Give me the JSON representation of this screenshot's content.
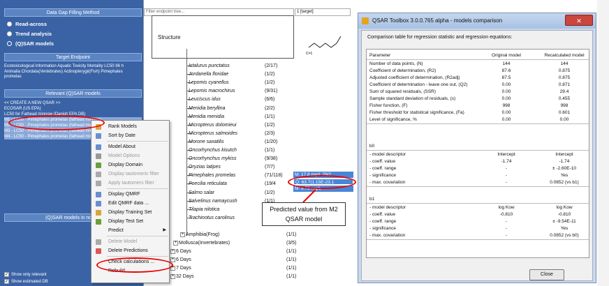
{
  "left_panel": {
    "method_header": "Data Gap Filling Method",
    "methods": [
      "Read-across",
      "Trend analysis",
      "(Q)SAR models"
    ],
    "target_header": "Target Endpoint",
    "target_text": "Ecotoxicological Information Aquatic Toxicity Mortality LC50 96 h Animalia Chordata(Vertebrates) Actinopterygii(Fish) Pimephales promelas",
    "relevant_header": "Relevant (Q)SAR models",
    "models": [
      "<< CREATE A NEW QSAR >>",
      "ECOSAR (US EPA)",
      "LC50 for Fathead minnow (Danish EPA DB)",
      "M1 - LC50 - Pimephales promelas (fathead minnow)",
      "M2 - LC50 - Pimephales promelas (fathead minnow)",
      "M3 - LC50 - Pimephales promelas (fathead minnow)",
      "M4 - LC50 - Pimephales promelas (fathead minnow)"
    ],
    "models_in_node_header": "(Q)SAR models in node",
    "checkboxes": [
      "Show only relevant",
      "Show estimated DB"
    ]
  },
  "middle": {
    "filter_placeholder": "Filter endpoint tree...",
    "target_col": "1 [target]",
    "structure_label": "Structure",
    "molecule_label": "C=1",
    "species": [
      {
        "name": "Ictalurus punctatus",
        "count": "(2/17)"
      },
      {
        "name": "Jordanella floridae",
        "count": "(1/2)"
      },
      {
        "name": "Lepomis cyanellus",
        "count": "(1/2)"
      },
      {
        "name": "Lepomis macrochirus",
        "count": "(9/31)"
      },
      {
        "name": "Leuciscus idus",
        "count": "(6/6)"
      },
      {
        "name": "Menidia beryllina",
        "count": "(2/2)"
      },
      {
        "name": "Menidia menidia",
        "count": "(1/1)"
      },
      {
        "name": "Micropterus dolomieui",
        "count": "(1/2)"
      },
      {
        "name": "Micropterus salmoides",
        "count": "(2/3)"
      },
      {
        "name": "Morone saxatilis",
        "count": "(1/20)"
      },
      {
        "name": "Oncorhynchus kisutch",
        "count": "(1/1)"
      },
      {
        "name": "Oncorhynchus mykiss",
        "count": "(9/38)"
      },
      {
        "name": "Oryzias latipes",
        "count": "(7/7)"
      },
      {
        "name": "Pimephales promelas",
        "count": "(71/118)"
      },
      {
        "name": "Poecilia reticulata",
        "count": "(19/4"
      },
      {
        "name": "Salmo salar",
        "count": "(1/2)"
      },
      {
        "name": "Salvelinus namaycush",
        "count": "(1/1)"
      },
      {
        "name": "Tilapia nilotica",
        "count": "(1/1)"
      },
      {
        "name": "Trachinotus carolinus",
        "count": "(1/1)"
      }
    ],
    "amphibia": {
      "name": "Amphibia(Frog)",
      "count": "(1/1)"
    },
    "mollusca": {
      "name": "Mollusca(Invertebrates)",
      "count": "(3/5)"
    },
    "days": [
      {
        "name": "6 Days",
        "count": "(1/1)"
      },
      {
        "name": "6 Days",
        "count": "(1/1)"
      },
      {
        "name": "7 Days",
        "count": "(1/1)"
      },
      {
        "name": "32 Days",
        "count": "(1/1)"
      }
    ],
    "pred_values": [
      "M: 17.8 mg/L 29/2",
      "Q: 63.7(1.15E-23.1",
      "M: 9.79 mg/L"
    ],
    "callout": "Predicted value from M2 QSAR model"
  },
  "context_menu": {
    "items": [
      {
        "label": "Rank Models",
        "disabled": false,
        "icon": "rank-icon"
      },
      {
        "label": "Sort by Date",
        "disabled": false,
        "icon": "sort-icon"
      },
      {
        "label": "Model About",
        "disabled": false,
        "icon": "about-icon"
      },
      {
        "label": "Model Options",
        "disabled": true,
        "icon": "options-icon"
      },
      {
        "label": "Display Domain",
        "disabled": false,
        "icon": "domain-icon"
      },
      {
        "label": "Display tautomeric filter",
        "disabled": true,
        "icon": "filter-icon"
      },
      {
        "label": "Apply tautomers filter",
        "disabled": true,
        "icon": "filter-icon"
      },
      {
        "label": "Display QMRF",
        "disabled": false,
        "icon": "doc-icon"
      },
      {
        "label": "Edit QMRF data ...",
        "disabled": false,
        "icon": "edit-icon"
      },
      {
        "label": "Display Training Set",
        "disabled": false,
        "icon": "training-icon"
      },
      {
        "label": "Display Test Set",
        "disabled": false,
        "icon": "test-icon"
      },
      {
        "label": "Predict",
        "disabled": false,
        "icon": "",
        "submenu": true
      },
      {
        "label": "Delete Model",
        "disabled": true,
        "icon": "delete-icon"
      },
      {
        "label": "Delete Predictions",
        "disabled": false,
        "icon": "delete-doc-icon"
      },
      {
        "label": "Check calculations ...",
        "disabled": false,
        "icon": ""
      },
      {
        "label": "Rebuild ...",
        "disabled": false,
        "icon": ""
      }
    ]
  },
  "dialog": {
    "title": "QSAR Toolbox 3.0.0.765 alpha - models comparison",
    "close_x": "✕",
    "description": "Comparison table for regression statistic and regression equations:",
    "columns": [
      "Parameter",
      "Original model",
      "Recalculated model"
    ],
    "rows": [
      [
        "Number of data points,  (N)",
        "144",
        "144"
      ],
      [
        "Coefficient of determination,  (R2)",
        "87.6",
        "0.875"
      ],
      [
        "Adjusted coefficient of determination,  (R2adj)",
        "87.5",
        "0.875"
      ],
      [
        "Coefficient of determination - leave one out,  (Q2)",
        "0.00",
        "0.871"
      ],
      [
        "Sum of squared residuals,  (SSR)",
        "0.00",
        "29.4"
      ],
      [
        "Sample standard deviation of residuals,  (s)",
        "0.00",
        "0.455"
      ],
      [
        "Fisher function,  (F)",
        "998",
        "998"
      ],
      [
        "Fisher threshold for statistical significance,  (Fa)",
        "0.00",
        "0.601"
      ],
      [
        "Level of significance, %",
        "0.00",
        "0.00"
      ]
    ],
    "b0_label": "b0",
    "b0_rows": [
      [
        " - model descriptor",
        "Intercept",
        "Intercept"
      ],
      [
        " - coeff. value",
        "-1.74",
        "-1.74"
      ],
      [
        " - coeff. range",
        "-",
        "± -2.60E-10"
      ],
      [
        " - significance",
        "-",
        "Yes"
      ],
      [
        " - max. covariation",
        "-",
        "0.0852  (vs b1)"
      ]
    ],
    "b1_label": "b1",
    "b1_rows": [
      [
        " - model descriptor",
        "log Kow",
        "log Kow"
      ],
      [
        " - coeff. value",
        "-0.810",
        "-0.810"
      ],
      [
        " - coeff. range",
        "-",
        "± -9.54E-11"
      ],
      [
        " - significance",
        "-",
        "Yes"
      ],
      [
        " - max. covariation",
        "-",
        "0.0852  (vs b0)"
      ]
    ],
    "close_button": "Close"
  },
  "colors": {
    "left_panel_bg": "#3a63a6",
    "selected_cell": "#4a86d6",
    "annotation_red": "#e00000"
  }
}
